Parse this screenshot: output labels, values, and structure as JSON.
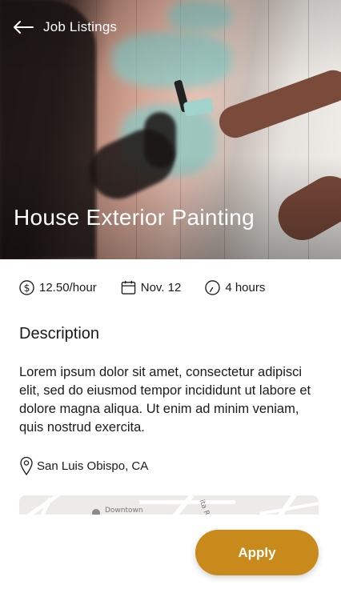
{
  "nav": {
    "back_label": "Job Listings"
  },
  "hero": {
    "title": "House Exterior Painting"
  },
  "meta": {
    "rate": "12.50/hour",
    "date": "Nov. 12",
    "duration": "4 hours"
  },
  "description": {
    "heading": "Description",
    "body": "Lorem ipsum dolor sit amet, consectetur adipisci elit, sed do eiusmod tempor incididunt ut labore et dolore magna aliqua. Ut enim ad minim veniam, quis nostrud exercita."
  },
  "location": {
    "text": "San Luis Obispo, CA"
  },
  "map": {
    "label_downtown": "Downtown",
    "label_street": "ita Rosa"
  },
  "actions": {
    "apply_label": "Apply"
  },
  "colors": {
    "accent": "#c98a1c",
    "text": "#1a1a1a"
  }
}
